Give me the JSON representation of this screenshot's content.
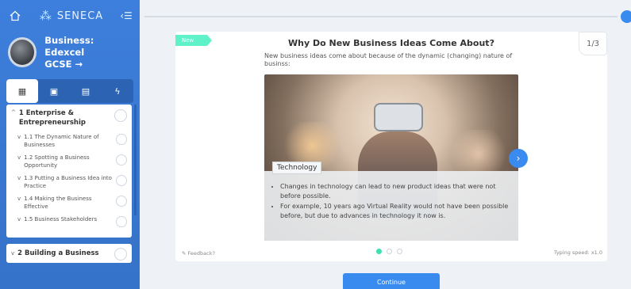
{
  "app": {
    "brand": "SENECA"
  },
  "course": {
    "title_line1": "Business: Edexcel",
    "title_line2": "GCSE →"
  },
  "tabs": [
    {
      "icon": "building-icon",
      "glyph": "▦"
    },
    {
      "icon": "calendar-icon",
      "glyph": "▣"
    },
    {
      "icon": "document-icon",
      "glyph": "▤"
    },
    {
      "icon": "lightning-icon",
      "glyph": "ϟ"
    }
  ],
  "outline": {
    "chapter1": {
      "chevron": "^",
      "label": "1 Enterprise & Entrepreneurship"
    },
    "subs": [
      {
        "label": "1.1 The Dynamic Nature of Businesses"
      },
      {
        "label": "1.2 Spotting a Business Opportunity"
      },
      {
        "label": "1.3 Putting a Business Idea into Practice"
      },
      {
        "label": "1.4 Making the Business Effective"
      },
      {
        "label": "1.5 Business Stakeholders"
      }
    ],
    "chapter2": {
      "chevron": "v",
      "label": "2 Building a Business"
    }
  },
  "card": {
    "badge": "New",
    "counter": "1/3",
    "title": "Why Do New Business Ideas Come About?",
    "subtitle": "New business ideas come about because of the dynamic (changing) nature of businss:",
    "image_label": "Technology",
    "bullets": [
      "Changes in technology can lead to new product ideas that were not before possible.",
      "For example, 10 years ago Virtual Reality would not have been possible before, but due to advances in technology it now is."
    ],
    "feedback": "Feedback?",
    "typing_speed": "Typing speed: x1.0"
  },
  "continue_label": "Continue"
}
